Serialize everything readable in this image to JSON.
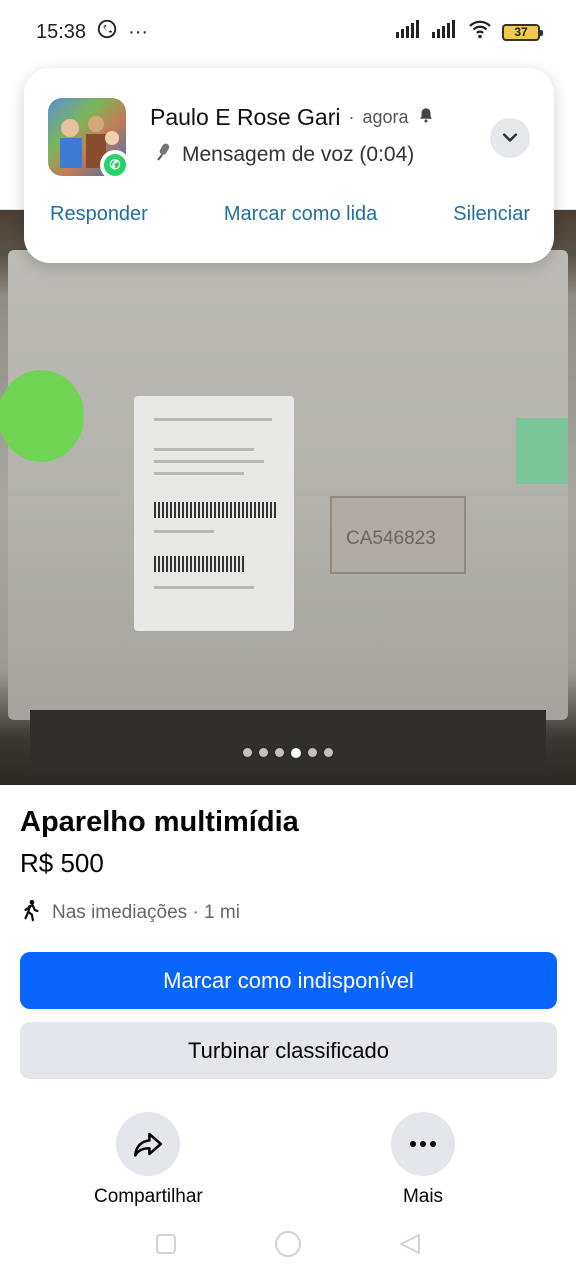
{
  "status_bar": {
    "time": "15:38",
    "ellipsis": "···",
    "battery": "37",
    "icons": [
      "whatsapp-icon",
      "signal-icon",
      "signal-icon",
      "wifi-icon",
      "battery-icon"
    ]
  },
  "notification": {
    "sender": "Paulo E Rose Gari",
    "separator": "·",
    "time": "agora",
    "message": "Mensagem de voz (0:04)",
    "actions": [
      "Responder",
      "Marcar como lida",
      "Silenciar"
    ]
  },
  "photo": {
    "sticker_text": "CA546823",
    "dots_total": 6,
    "dot_active_index": 3
  },
  "listing": {
    "title": "Aparelho multimídia",
    "price": "R$ 500",
    "location": "Nas imediações · 1 mi"
  },
  "buttons": {
    "primary": "Marcar como indisponível",
    "secondary": "Turbinar classificado"
  },
  "actions": {
    "share": "Compartilhar",
    "more": "Mais"
  },
  "colors": {
    "primary_blue": "#0866ff",
    "secondary_gray": "#e4e6eb",
    "notification_action": "#1f6fa3",
    "whatsapp_green": "#25d366"
  }
}
